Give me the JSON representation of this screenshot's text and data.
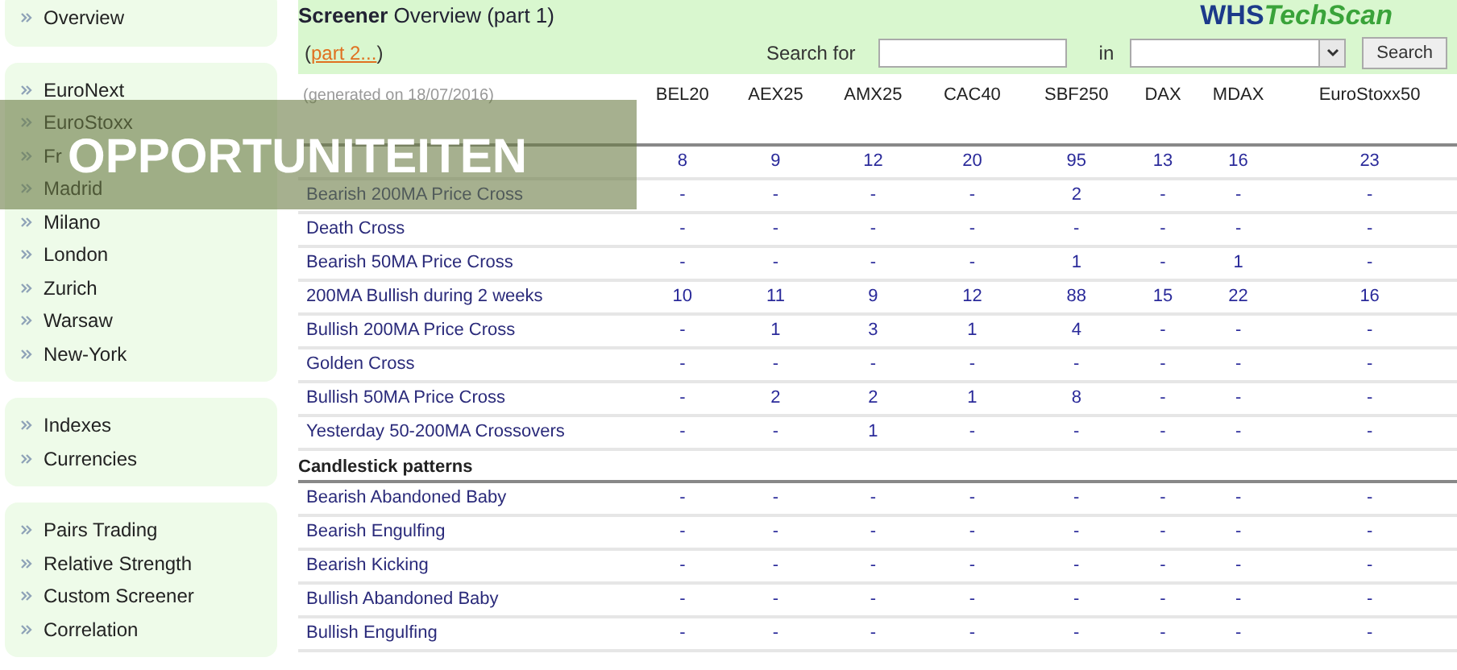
{
  "sidebar": {
    "groups": [
      {
        "items": [
          "Overview"
        ]
      },
      {
        "items": [
          "EuroNext",
          "EuroStoxx",
          "Fr",
          "Madrid",
          "Milano",
          "London",
          "Zurich",
          "Warsaw",
          "New-York"
        ]
      },
      {
        "items": [
          "Indexes",
          "Currencies"
        ]
      },
      {
        "items": [
          "Pairs Trading",
          "Relative Strength",
          "Custom Screener",
          "Correlation"
        ]
      }
    ]
  },
  "header": {
    "title_bold": "Screener",
    "title": "Overview (part 1)",
    "logo": [
      "WHS",
      "TechScan"
    ],
    "part_link": "part 2...",
    "link_open": "(",
    "link_close": ")",
    "search_label": "Search for",
    "in_label": "in",
    "search_button": "Search"
  },
  "table": {
    "generated": "(generated on 18/07/2016)",
    "columns": [
      "BEL20",
      "AEX25",
      "AMX25",
      "CAC40",
      "SBF250",
      "DAX",
      "MDAX",
      "EuroStoxx50"
    ],
    "sections": [
      {
        "rows": [
          {
            "values": [
              "8",
              "9",
              "12",
              "20",
              "95",
              "13",
              "16",
              "23"
            ]
          },
          {
            "label": "Bearish 200MA Price Cross",
            "values": [
              "-",
              "-",
              "-",
              "-",
              "2",
              "-",
              "-",
              "-"
            ]
          },
          {
            "label": "Death Cross",
            "values": [
              "-",
              "-",
              "-",
              "-",
              "-",
              "-",
              "-",
              "-"
            ]
          },
          {
            "label": "Bearish 50MA Price Cross",
            "values": [
              "-",
              "-",
              "-",
              "-",
              "1",
              "-",
              "1",
              "-"
            ]
          },
          {
            "label": "200MA Bullish during 2 weeks",
            "values": [
              "10",
              "11",
              "9",
              "12",
              "88",
              "15",
              "22",
              "16"
            ]
          },
          {
            "label": "Bullish 200MA Price Cross",
            "values": [
              "-",
              "1",
              "3",
              "1",
              "4",
              "-",
              "-",
              "-"
            ]
          },
          {
            "label": "Golden Cross",
            "values": [
              "-",
              "-",
              "-",
              "-",
              "-",
              "-",
              "-",
              "-"
            ]
          },
          {
            "label": "Bullish 50MA Price Cross",
            "values": [
              "-",
              "2",
              "2",
              "1",
              "8",
              "-",
              "-",
              "-"
            ]
          },
          {
            "label": "Yesterday 50-200MA Crossovers",
            "values": [
              "-",
              "-",
              "1",
              "-",
              "-",
              "-",
              "-",
              "-"
            ]
          }
        ]
      },
      {
        "title": "Candlestick patterns",
        "rows": [
          {
            "label": "Bearish Abandoned Baby",
            "values": [
              "-",
              "-",
              "-",
              "-",
              "-",
              "-",
              "-",
              "-"
            ]
          },
          {
            "label": "Bearish Engulfing",
            "values": [
              "-",
              "-",
              "-",
              "-",
              "-",
              "-",
              "-",
              "-"
            ]
          },
          {
            "label": "Bearish Kicking",
            "values": [
              "-",
              "-",
              "-",
              "-",
              "-",
              "-",
              "-",
              "-"
            ]
          },
          {
            "label": "Bullish Abandoned Baby",
            "values": [
              "-",
              "-",
              "-",
              "-",
              "-",
              "-",
              "-",
              "-"
            ]
          },
          {
            "label": "Bullish Engulfing",
            "values": [
              "-",
              "-",
              "-",
              "-",
              "-",
              "-",
              "-",
              "-"
            ]
          }
        ]
      }
    ]
  },
  "banner": {
    "text": "OPPORTUNITEITEN"
  }
}
